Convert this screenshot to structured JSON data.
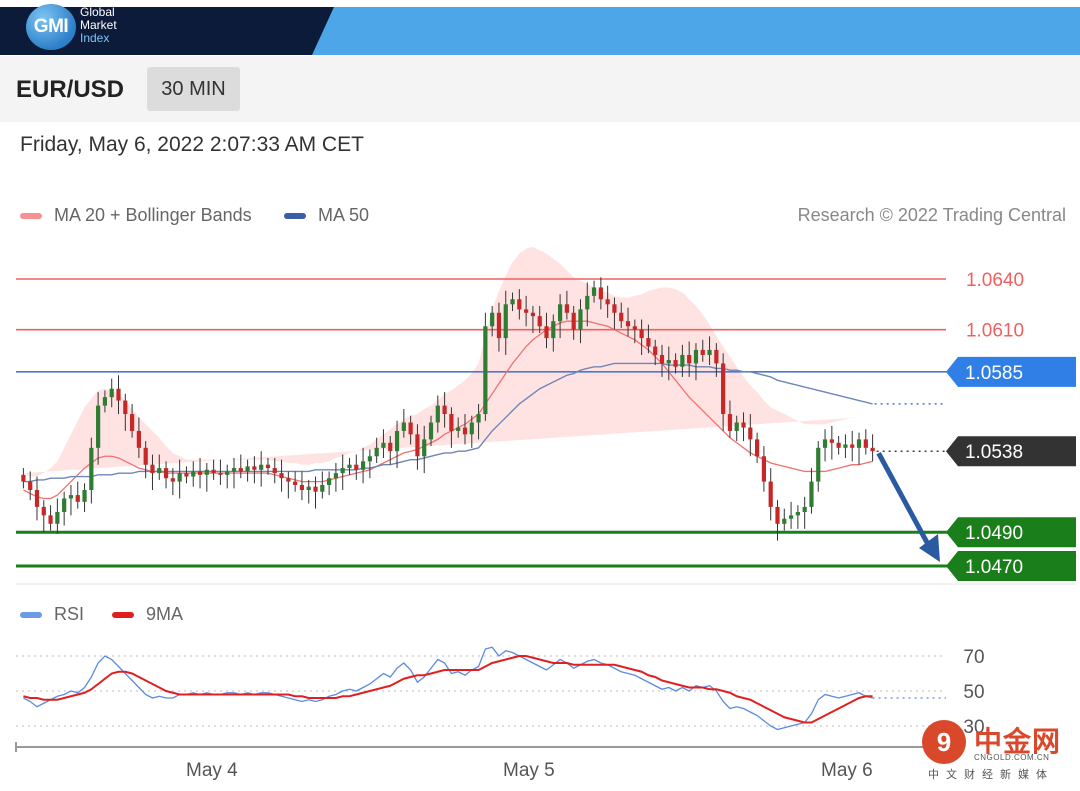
{
  "header": {
    "logo_mark": "GMI",
    "logo_lines": [
      "Global",
      "Market",
      "Index"
    ],
    "brand_dark": "#0d1b3a",
    "brand_light": "#4da6e8"
  },
  "instrument": {
    "pair": "EUR/USD",
    "timeframe": "30 MIN"
  },
  "timestamp": "Friday, May 6, 2022 2:07:33 AM CET",
  "legend": {
    "ma20_label": "MA 20 + Bollinger Bands",
    "ma50_label": "MA 50",
    "research": "Research © 2022 Trading Central",
    "rsi_label": "RSI",
    "rsi_ma_label": "9MA"
  },
  "colors": {
    "resistance": "#f06060",
    "ma50_line": "#4a78d0",
    "support": "#1a7f1a",
    "current_badge": "#333333",
    "arrow": "#2a5aa0",
    "bollinger_fill": "#ffdede",
    "candle_up": "#2e7d32",
    "candle_down": "#c62828",
    "rsi_line": "#5b8be0",
    "rsi_ma_line": "#e02020"
  },
  "chart_data": [
    {
      "type": "candlestick",
      "title": "EUR/USD 30 MIN",
      "x_tick_labels": [
        "May 4",
        "May 5",
        "May 6"
      ],
      "ylim": [
        1.0462,
        1.065
      ],
      "grid": false,
      "levels": [
        {
          "value": 1.064,
          "label": "1.0640",
          "kind": "resistance"
        },
        {
          "value": 1.061,
          "label": "1.0610",
          "kind": "resistance"
        },
        {
          "value": 1.0585,
          "label": "1.0585",
          "kind": "pivot"
        },
        {
          "value": 1.0538,
          "label": "1.0538",
          "kind": "current"
        },
        {
          "value": 1.049,
          "label": "1.0490",
          "kind": "support"
        },
        {
          "value": 1.047,
          "label": "1.0470",
          "kind": "support"
        }
      ],
      "close": [
        1.052,
        1.0515,
        1.0505,
        1.05,
        1.0495,
        1.0502,
        1.051,
        1.0512,
        1.0508,
        1.0515,
        1.054,
        1.0565,
        1.057,
        1.0575,
        1.0568,
        1.056,
        1.055,
        1.054,
        1.053,
        1.0525,
        1.0528,
        1.0522,
        1.052,
        1.0525,
        1.0523,
        1.0526,
        1.0524,
        1.0527,
        1.0525,
        1.0524,
        1.0526,
        1.0528,
        1.0526,
        1.0529,
        1.0527,
        1.053,
        1.0528,
        1.0525,
        1.0522,
        1.052,
        1.0518,
        1.0515,
        1.0517,
        1.0514,
        1.0518,
        1.0522,
        1.0525,
        1.0528,
        1.053,
        1.0527,
        1.0532,
        1.0535,
        1.054,
        1.0543,
        1.0538,
        1.055,
        1.0555,
        1.0548,
        1.0535,
        1.0545,
        1.0555,
        1.0565,
        1.056,
        1.055,
        1.0552,
        1.0548,
        1.0555,
        1.056,
        1.0612,
        1.062,
        1.0605,
        1.0625,
        1.0628,
        1.0622,
        1.062,
        1.0618,
        1.0612,
        1.0605,
        1.0615,
        1.0625,
        1.062,
        1.061,
        1.0622,
        1.063,
        1.0635,
        1.0628,
        1.0625,
        1.062,
        1.0615,
        1.0612,
        1.061,
        1.0605,
        1.06,
        1.0595,
        1.059,
        1.0592,
        1.0588,
        1.0595,
        1.059,
        1.0598,
        1.0595,
        1.0598,
        1.059,
        1.056,
        1.055,
        1.0555,
        1.0552,
        1.0545,
        1.0535,
        1.052,
        1.0505,
        1.0495,
        1.0498,
        1.05,
        1.0502,
        1.0505,
        1.052,
        1.054,
        1.0545,
        1.0543,
        1.054,
        1.0542,
        1.054,
        1.0545,
        1.054,
        1.0538
      ],
      "ma20": [
        1.0515,
        1.0513,
        1.0511,
        1.051,
        1.051,
        1.0512,
        1.0516,
        1.052,
        1.0524,
        1.0528,
        1.0531,
        1.0534,
        1.0535,
        1.0535,
        1.0534,
        1.0532,
        1.053,
        1.0528,
        1.0527,
        1.0526,
        1.0526,
        1.0525,
        1.0525,
        1.0525,
        1.0525,
        1.0525,
        1.0525,
        1.0525,
        1.0525,
        1.0525,
        1.0525,
        1.0525,
        1.0525,
        1.0525,
        1.0525,
        1.0525,
        1.0525,
        1.0524,
        1.0523,
        1.0522,
        1.0521,
        1.052,
        1.052,
        1.052,
        1.052,
        1.0521,
        1.0522,
        1.0523,
        1.0524,
        1.0525,
        1.0526,
        1.0527,
        1.0529,
        1.0531,
        1.0533,
        1.0535,
        1.0537,
        1.0538,
        1.0539,
        1.0541,
        1.0543,
        1.0545,
        1.0548,
        1.055,
        1.0552,
        1.0554,
        1.0557,
        1.056,
        1.0566,
        1.0572,
        1.0578,
        1.0584,
        1.059,
        1.0595,
        1.06,
        1.0604,
        1.0607,
        1.061,
        1.0612,
        1.0614,
        1.0615,
        1.0615,
        1.0615,
        1.0615,
        1.0614,
        1.0613,
        1.0612,
        1.061,
        1.0608,
        1.0606,
        1.0604,
        1.0601,
        1.0598,
        1.0594,
        1.059,
        1.0585,
        1.058,
        1.0575,
        1.057,
        1.0566,
        1.0562,
        1.0558,
        1.0554,
        1.055,
        1.0546,
        1.0543,
        1.054,
        1.0537,
        1.0535,
        1.0533,
        1.0531,
        1.053,
        1.0529,
        1.0528,
        1.0527,
        1.0526,
        1.0526,
        1.0526,
        1.0526,
        1.0527,
        1.0528,
        1.0529,
        1.053,
        1.053,
        1.0531,
        1.0532
      ],
      "ma50": [
        1.052,
        1.052,
        1.0521,
        1.0521,
        1.0522,
        1.0522,
        1.0522,
        1.0523,
        1.0523,
        1.0523,
        1.0523,
        1.0524,
        1.0524,
        1.0524,
        1.0525,
        1.0525,
        1.0525,
        1.0526,
        1.0526,
        1.0526,
        1.0526,
        1.0526,
        1.0526,
        1.0526,
        1.0526,
        1.0526,
        1.0526,
        1.0526,
        1.0526,
        1.0526,
        1.0526,
        1.0526,
        1.0526,
        1.0526,
        1.0526,
        1.0526,
        1.0526,
        1.0526,
        1.0526,
        1.0526,
        1.0526,
        1.0526,
        1.0526,
        1.0527,
        1.0527,
        1.0527,
        1.0527,
        1.0527,
        1.0527,
        1.0527,
        1.0528,
        1.0528,
        1.0529,
        1.053,
        1.053,
        1.0531,
        1.0532,
        1.0533,
        1.0533,
        1.0534,
        1.0535,
        1.0536,
        1.0537,
        1.0537,
        1.0538,
        1.0538,
        1.0539,
        1.054,
        1.0545,
        1.055,
        1.0554,
        1.0558,
        1.0562,
        1.0566,
        1.0569,
        1.0572,
        1.0575,
        1.0577,
        1.0579,
        1.0581,
        1.0583,
        1.0584,
        1.0586,
        1.0587,
        1.0588,
        1.0588,
        1.0589,
        1.059,
        1.059,
        1.059,
        1.059,
        1.059,
        1.059,
        1.059,
        1.059,
        1.0589,
        1.0589,
        1.0589,
        1.0589,
        1.0588,
        1.0588,
        1.0588,
        1.0587,
        1.0587,
        1.0586,
        1.0586,
        1.0585,
        1.0585,
        1.0584,
        1.0583,
        1.0582,
        1.058,
        1.0579,
        1.0578,
        1.0577,
        1.0576,
        1.0575,
        1.0574,
        1.0573,
        1.0572,
        1.0571,
        1.057,
        1.0569,
        1.0568,
        1.0567,
        1.0566
      ],
      "bollinger_width": [
        0.001,
        0.001,
        0.0012,
        0.0015,
        0.0018,
        0.002,
        0.0024,
        0.0028,
        0.0032,
        0.0036,
        0.0038,
        0.004,
        0.004,
        0.0039,
        0.0038,
        0.0036,
        0.0033,
        0.003,
        0.0027,
        0.0024,
        0.002,
        0.0016,
        0.0012,
        0.001,
        0.0008,
        0.0008,
        0.0008,
        0.0008,
        0.0008,
        0.0008,
        0.0008,
        0.0008,
        0.0008,
        0.0008,
        0.0008,
        0.0008,
        0.0008,
        0.0008,
        0.0009,
        0.0009,
        0.001,
        0.001,
        0.001,
        0.0011,
        0.0011,
        0.0011,
        0.0012,
        0.0012,
        0.0013,
        0.0013,
        0.0014,
        0.0015,
        0.0016,
        0.0017,
        0.0018,
        0.0019,
        0.002,
        0.0021,
        0.0021,
        0.0022,
        0.0022,
        0.0023,
        0.0024,
        0.0024,
        0.0025,
        0.0026,
        0.0027,
        0.003,
        0.004,
        0.005,
        0.0055,
        0.0058,
        0.006,
        0.006,
        0.0058,
        0.0055,
        0.005,
        0.0045,
        0.004,
        0.0035,
        0.003,
        0.0026,
        0.0024,
        0.0022,
        0.0021,
        0.002,
        0.002,
        0.002,
        0.0021,
        0.0023,
        0.0026,
        0.003,
        0.0035,
        0.004,
        0.0045,
        0.005,
        0.0054,
        0.0057,
        0.0058,
        0.0058,
        0.0057,
        0.0055,
        0.0052,
        0.005,
        0.0048,
        0.0045,
        0.0042,
        0.004,
        0.0038,
        0.0035,
        0.0033,
        0.0032,
        0.0031,
        0.003,
        0.0029,
        0.0028,
        0.0028,
        0.0028,
        0.0028,
        0.0028,
        0.0028,
        0.0028,
        0.0028,
        0.0028
      ],
      "forecast": {
        "from": 1.0538,
        "to": 1.047,
        "direction": "down"
      }
    },
    {
      "type": "line",
      "title": "RSI",
      "ylim": [
        25,
        75
      ],
      "y_tick_labels": [
        "70",
        "50",
        "30"
      ],
      "series": [
        {
          "name": "RSI",
          "values": [
            46,
            44,
            41,
            43,
            45,
            47,
            48,
            50,
            49,
            52,
            58,
            66,
            70,
            68,
            64,
            60,
            56,
            52,
            48,
            46,
            47,
            46,
            46,
            48,
            48,
            49,
            48,
            49,
            48,
            48,
            49,
            49,
            48,
            49,
            48,
            49,
            49,
            48,
            47,
            46,
            45,
            44,
            45,
            44,
            45,
            47,
            48,
            50,
            51,
            50,
            52,
            54,
            57,
            60,
            58,
            63,
            66,
            62,
            55,
            58,
            63,
            68,
            66,
            60,
            61,
            59,
            62,
            64,
            74,
            75,
            70,
            73,
            72,
            70,
            68,
            66,
            64,
            62,
            65,
            68,
            66,
            63,
            65,
            67,
            68,
            66,
            65,
            63,
            61,
            60,
            59,
            57,
            55,
            53,
            51,
            52,
            50,
            52,
            50,
            53,
            52,
            53,
            50,
            44,
            40,
            41,
            40,
            38,
            36,
            33,
            30,
            28,
            29,
            30,
            31,
            32,
            37,
            45,
            48,
            47,
            46,
            47,
            48,
            49,
            47,
            46
          ]
        },
        {
          "name": "9MA",
          "values": [
            47,
            46,
            46,
            45,
            45,
            45,
            46,
            47,
            48,
            49,
            51,
            54,
            57,
            60,
            61,
            61,
            60,
            58,
            56,
            54,
            52,
            50,
            49,
            48,
            48,
            48,
            48,
            48,
            48,
            48,
            48,
            48,
            48,
            48,
            48,
            48,
            48,
            48,
            48,
            48,
            47,
            47,
            46,
            46,
            46,
            46,
            46,
            47,
            47,
            48,
            49,
            50,
            51,
            52,
            53,
            55,
            57,
            58,
            59,
            59,
            60,
            61,
            62,
            62,
            62,
            62,
            62,
            62,
            64,
            66,
            67,
            68,
            69,
            70,
            70,
            69,
            68,
            67,
            66,
            66,
            66,
            65,
            65,
            65,
            65,
            65,
            65,
            65,
            64,
            63,
            62,
            61,
            59,
            58,
            56,
            55,
            54,
            53,
            52,
            52,
            52,
            51,
            51,
            50,
            49,
            47,
            46,
            45,
            43,
            41,
            39,
            37,
            35,
            34,
            33,
            32,
            32,
            34,
            36,
            38,
            40,
            42,
            44,
            46,
            47,
            47
          ]
        }
      ]
    }
  ],
  "watermark": {
    "mark": "9",
    "name": "中金网",
    "domain": "CNGOLD.COM.CN",
    "sub": "中文财经新媒体"
  }
}
